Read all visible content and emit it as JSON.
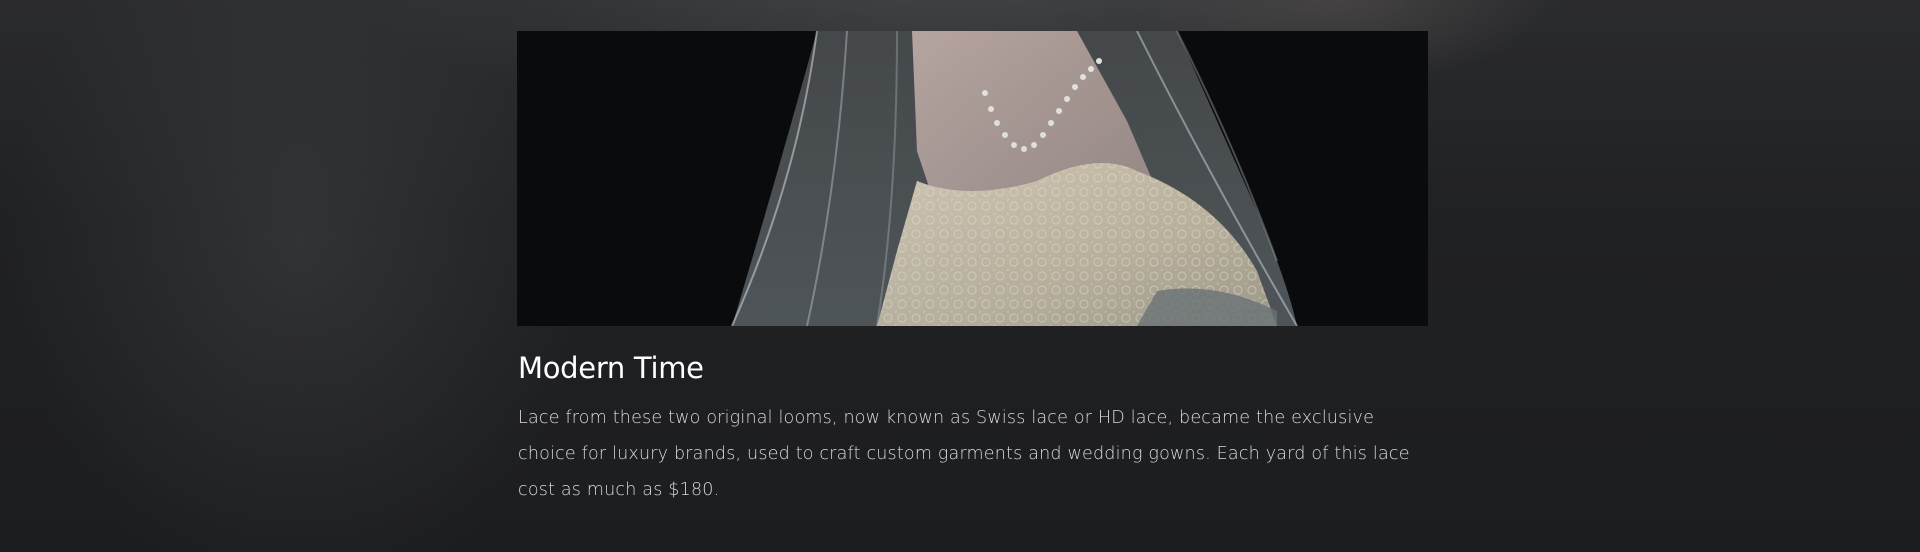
{
  "article": {
    "image_alt": "Bride in a sheer veil wearing a pearl necklace and an antique lace gown",
    "title": "Modern Time",
    "body": "Lace from these two original looms, now known as Swiss lace or HD lace, became the exclusive choice for luxury brands, used to craft custom garments and wedding gowns. Each yard of this lace cost as much as $180."
  },
  "colors": {
    "background": "#1d1e20",
    "title": "#ffffff",
    "body_text": "#d9d9db"
  }
}
